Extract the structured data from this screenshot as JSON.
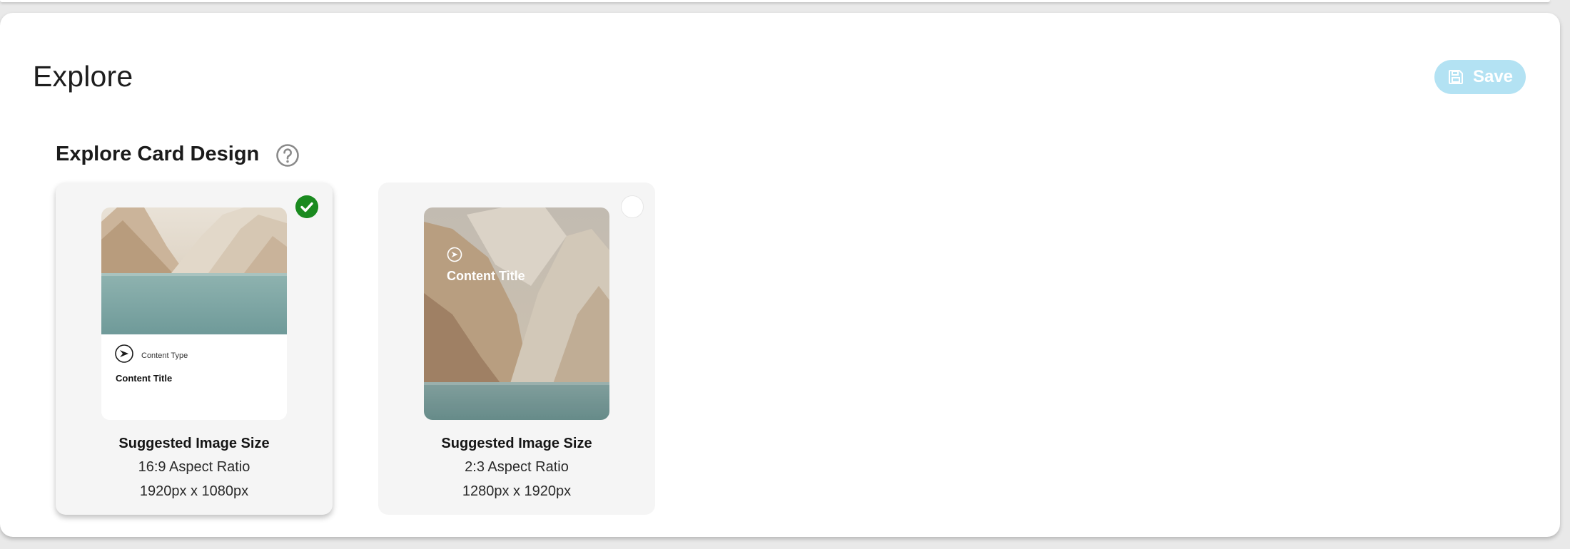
{
  "page": {
    "title": "Explore",
    "save_label": "Save"
  },
  "section": {
    "title": "Explore Card Design",
    "help_icon": "help-circle-icon"
  },
  "options": [
    {
      "selected": true,
      "preview": {
        "content_type": "Content Type",
        "content_title": "Content Title"
      },
      "size_heading": "Suggested Image Size",
      "aspect_ratio": "16:9 Aspect Ratio",
      "dimensions": "1920px x 1080px"
    },
    {
      "selected": false,
      "preview": {
        "content_title": "Content Title"
      },
      "size_heading": "Suggested Image Size",
      "aspect_ratio": "2:3 Aspect Ratio",
      "dimensions": "1280px x 1920px"
    }
  ],
  "colors": {
    "save_button_bg": "#b3e2f3",
    "selected_check": "#1a8a1f",
    "card_bg": "#f5f5f5"
  }
}
